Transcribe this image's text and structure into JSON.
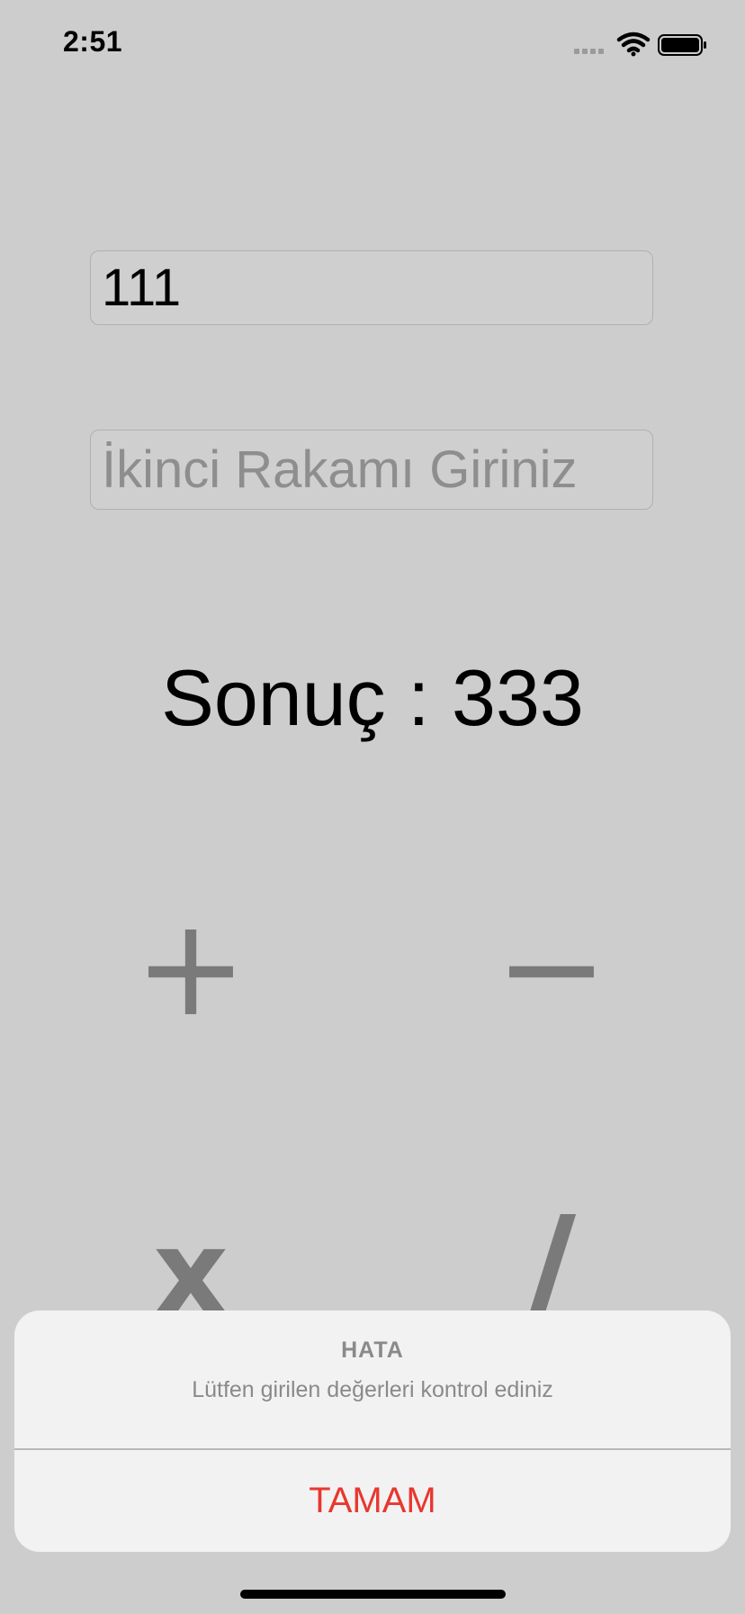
{
  "status_bar": {
    "time": "2:51",
    "icons": [
      "signal-icon",
      "wifi-icon",
      "battery-icon"
    ]
  },
  "form": {
    "first_number": {
      "value": "111",
      "placeholder": ""
    },
    "second_number": {
      "value": "",
      "placeholder": "İkinci Rakamı Giriniz"
    }
  },
  "result": {
    "label": "Sonuç : 333"
  },
  "operations": {
    "add": "+",
    "subtract": "−",
    "multiply": "x",
    "divide": "/"
  },
  "alert": {
    "title": "HATA",
    "message": "Lütfen girilen değerleri kontrol ediniz",
    "action_label": "TAMAM"
  },
  "colors": {
    "background": "#cdcdcd",
    "alert_action": "#e8372f",
    "operator": "#7a7a7a"
  }
}
